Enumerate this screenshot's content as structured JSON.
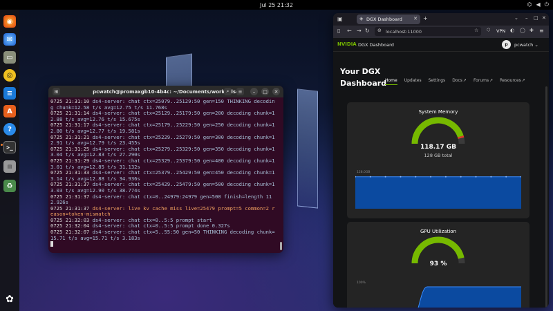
{
  "topbar": {
    "datetime": "Jul 25  21:32"
  },
  "terminal": {
    "title": "pcwatch@promaxgb10-4b4c: ~/Documents/works/ds4",
    "lines": [
      {
        "ts": "0725 21:31:10",
        "msg": " ds4-server: chat ctx=25079..25129:50 gen=150 THINKING decoding chunk=12.58 t/s avg=12.75 t/s 11.768s",
        "warn": false
      },
      {
        "ts": "0725 21:31:14",
        "msg": " ds4-server: chat ctx=25129..25179:50 gen=200 decoding chunk=12.88 t/s avg=12.76 t/s 15.675s",
        "warn": false
      },
      {
        "ts": "0725 21:31:17",
        "msg": " ds4-server: chat ctx=25179..25229:50 gen=250 decoding chunk=12.80 t/s avg=12.77 t/s 19.581s",
        "warn": false
      },
      {
        "ts": "0725 21:31:21",
        "msg": " ds4-server: chat ctx=25229..25279:50 gen=300 decoding chunk=12.91 t/s avg=12.79 t/s 23.455s",
        "warn": false
      },
      {
        "ts": "0725 21:31:25",
        "msg": " ds4-server: chat ctx=25279..25329:50 gen=350 decoding chunk=13.04 t/s avg=12.83 t/s 27.290s",
        "warn": false
      },
      {
        "ts": "0725 21:31:29",
        "msg": " ds4-server: chat ctx=25329..25379:50 gen=400 decoding chunk=13.01 t/s avg=12.85 t/s 31.132s",
        "warn": false
      },
      {
        "ts": "0725 21:31:33",
        "msg": " ds4-server: chat ctx=25379..25429:50 gen=450 decoding chunk=13.14 t/s avg=12.88 t/s 34.936s",
        "warn": false
      },
      {
        "ts": "0725 21:31:37",
        "msg": " ds4-server: chat ctx=25429..25479:50 gen=500 decoding chunk=13.03 t/s avg=12.90 t/s 38.774s",
        "warn": false
      },
      {
        "ts": "0725 21:31:37",
        "msg": " ds4-server: chat ctx=0..24979:24979 gen=500 finish=length 112.926s",
        "warn": false
      },
      {
        "ts": "0725 21:31:37",
        "msg": " ds4-server: live kv cache miss live=25479 prompt=5 common=2 reason=token-mismatch",
        "warn": true
      },
      {
        "ts": "0725 21:32:03",
        "msg": " ds4-server: chat ctx=0..5:5 prompt start",
        "warn": false
      },
      {
        "ts": "0725 21:32:04",
        "msg": " ds4-server: chat ctx=0..5:5 prompt done 0.327s",
        "warn": false
      },
      {
        "ts": "0725 21:32:07",
        "msg": " ds4-server: chat ctx=5..55:50 gen=50 THINKING decoding chunk=15.71 t/s avg=15.71 t/s 3.183s",
        "warn": false
      }
    ]
  },
  "browser": {
    "tab_title": "DGX Dashboard",
    "url": "localhost:11000",
    "vpn_label": "VPN"
  },
  "dashboard": {
    "brand": "NVIDIA",
    "app_name": "DGX Dashboard",
    "avatar_initial": "p",
    "username": "pcwatch",
    "title": "Your DGX Dashboard",
    "nav": [
      "Home",
      "Updates",
      "Settings",
      "Docs",
      "Forums",
      "Resources"
    ],
    "memory": {
      "title": "System Memory",
      "value": "118.17 GB",
      "total": "128 GB total",
      "fraction": 0.923,
      "chart_label": "128.0GB"
    },
    "gpu": {
      "title": "GPU Utilization",
      "value": "93 %",
      "fraction": 0.93,
      "chart_label": "100%"
    }
  },
  "colors": {
    "accent": "#76b900",
    "chart_fill": "#0b4aa0",
    "chart_line": "#3a8cff",
    "terminal_bg": "#300a24"
  },
  "dock": [
    "firefox-icon",
    "thunderbird-icon",
    "files-icon",
    "rhythmbox-icon",
    "writer-icon",
    "software-icon",
    "help-icon",
    "terminal-icon",
    "drive-icon",
    "trash-icon",
    "apps-grid-icon"
  ]
}
